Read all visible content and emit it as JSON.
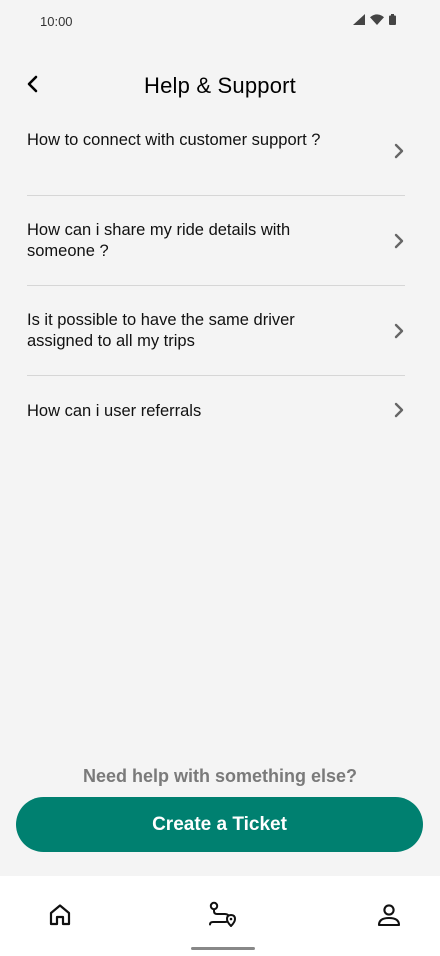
{
  "status_bar": {
    "time": "10:00",
    "icons": [
      "signal-icon",
      "wifi-icon",
      "battery-icon"
    ]
  },
  "header": {
    "title": "Help & Support",
    "back_icon": "back-arrow-icon"
  },
  "faq": {
    "items": [
      {
        "text": "How to connect with customer support ?"
      },
      {
        "text": "How can i share my ride details with someone ?"
      },
      {
        "text": "Is it possible to have the same driver assigned to all my trips"
      },
      {
        "text": "How can i user referrals"
      }
    ]
  },
  "footer": {
    "prompt": "Need help with something else?",
    "cta_label": "Create a Ticket"
  },
  "bottom_nav": {
    "items": [
      "home-icon",
      "rides-route-icon",
      "profile-icon"
    ]
  },
  "colors": {
    "accent": "#008070",
    "background": "#f4f4f4",
    "prompt_text": "#7a7a7a"
  }
}
